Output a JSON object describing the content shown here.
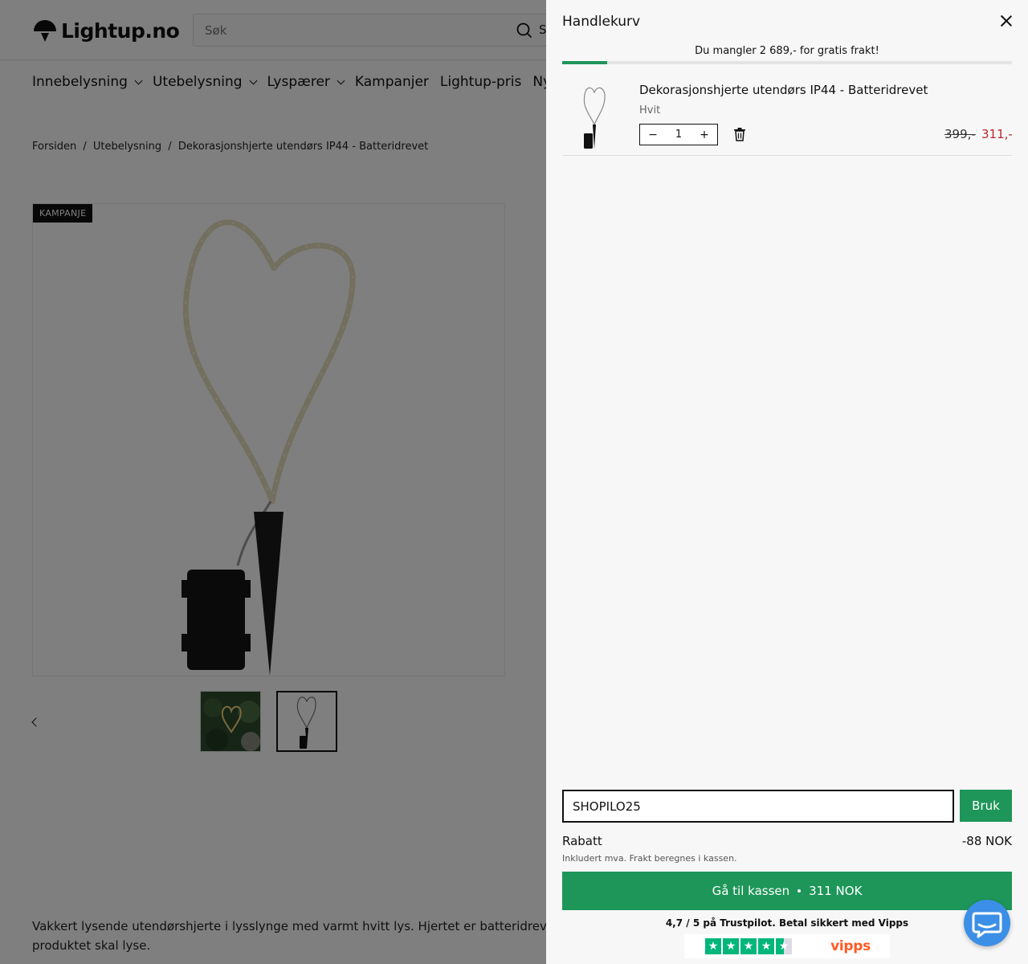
{
  "header": {
    "logo_text": "Lightup.no",
    "search_placeholder": "Søk",
    "search_button_label": "S"
  },
  "nav": [
    {
      "label": "Innebelysning",
      "has_dropdown": true
    },
    {
      "label": "Utebelysning",
      "has_dropdown": true
    },
    {
      "label": "Lyspærer",
      "has_dropdown": true
    },
    {
      "label": "Kampanjer",
      "has_dropdown": false
    },
    {
      "label": "Lightup-pris",
      "has_dropdown": false
    },
    {
      "label": "Nyh",
      "has_dropdown": false
    }
  ],
  "breadcrumb": [
    "Forsiden",
    "/",
    "Utebelysning",
    "/",
    "Dekorasjonshjerte utendørs IP44 - Batteridrevet"
  ],
  "product": {
    "badge": "KAMPANJE",
    "description": "Vakkert lysende utendørshjerte i lysslynge med varmt hvitt lys. Hjertet er batteridrevet",
    "description_line2": "produktet skal lyse."
  },
  "cart": {
    "title": "Handlekurv",
    "free_shipping_text": "Du mangler 2 689,- for gratis frakt!",
    "free_shipping_progress": 0.1,
    "items": [
      {
        "title": "Dekorasjonshjerte utendørs IP44 - Batteridrevet",
        "variant": "Hvit",
        "quantity": "1",
        "price_old": "399,-",
        "price_new": "311,-"
      }
    ],
    "coupon_value": "SHOPILO25",
    "apply_label": "Bruk",
    "discount_label": "Rabatt",
    "discount_value": "-88 NOK",
    "tax_note": "Inkludert mva. Frakt beregnes i kassen.",
    "checkout_label": "Gå til kassen",
    "checkout_total": "311 NOK",
    "trust_text": "4,7 / 5 på Trustpilot. Betal sikkert med Vipps",
    "vipps_label": "vipps",
    "trustpilot_rating": 4.5
  },
  "colors": {
    "accent_green": "#1e965a",
    "sale_red": "#c0262d",
    "trustpilot_green": "#00b67a",
    "vipps_orange": "#ff5b24",
    "chat_blue": "#3c8fe6"
  }
}
